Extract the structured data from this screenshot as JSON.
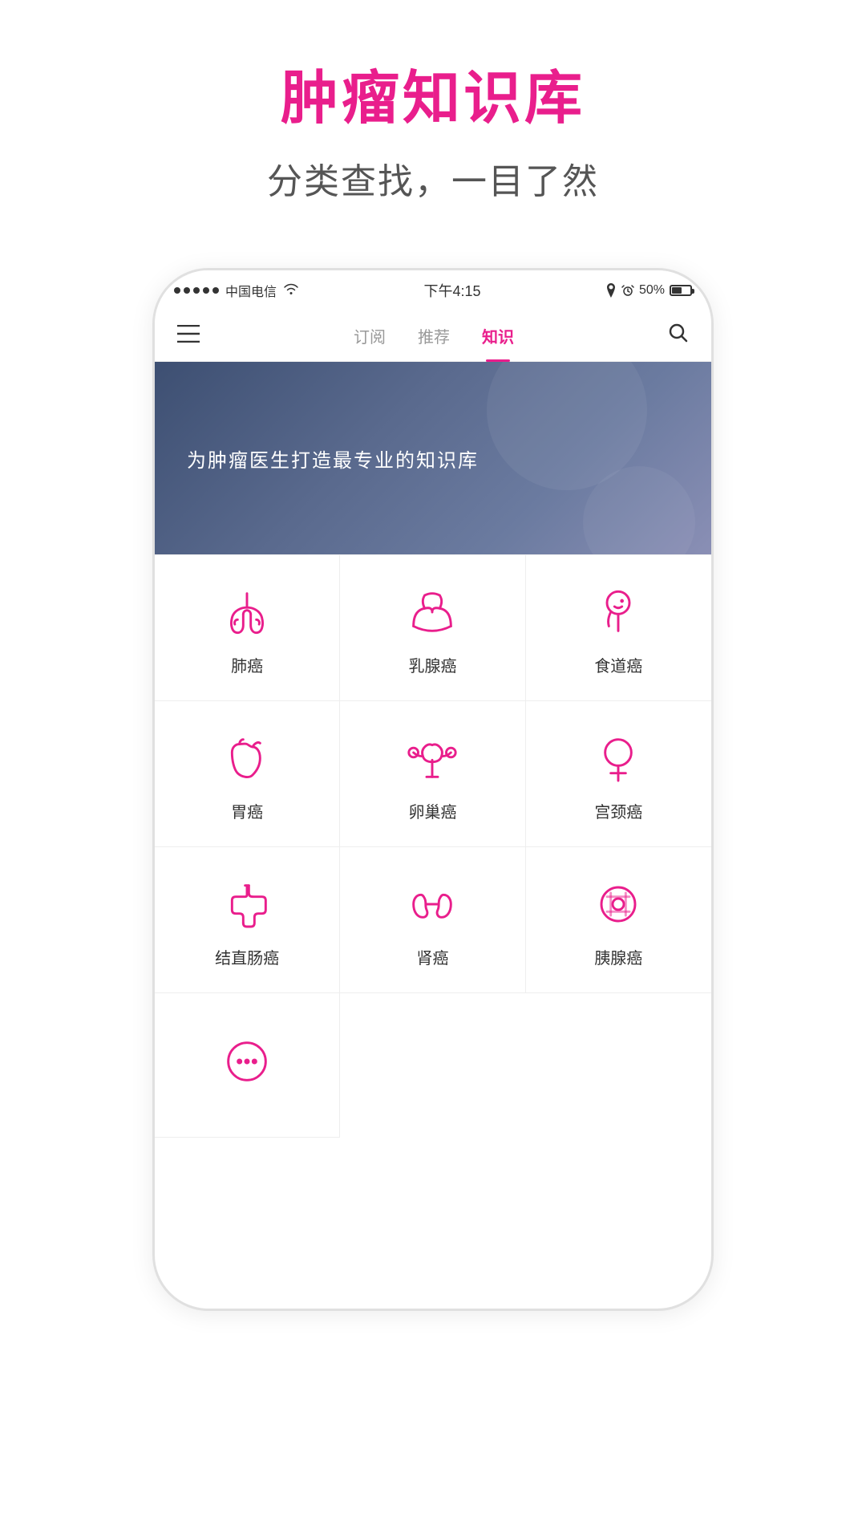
{
  "header": {
    "title": "肿瘤知识库",
    "subtitle": "分类查找，一目了然"
  },
  "statusBar": {
    "carrier": "中国电信",
    "time": "下午4:15",
    "battery": "50%"
  },
  "navBar": {
    "tabs": [
      {
        "label": "订阅",
        "active": false
      },
      {
        "label": "推荐",
        "active": false
      },
      {
        "label": "知识",
        "active": true
      }
    ]
  },
  "banner": {
    "text": "为肿瘤医生打造最专业的知识库"
  },
  "grid": {
    "items": [
      {
        "id": "lung",
        "label": "肺癌",
        "icon": "lung"
      },
      {
        "id": "breast",
        "label": "乳腺癌",
        "icon": "breast"
      },
      {
        "id": "esophagus",
        "label": "食道癌",
        "icon": "esophagus"
      },
      {
        "id": "stomach",
        "label": "胃癌",
        "icon": "stomach"
      },
      {
        "id": "ovary",
        "label": "卵巢癌",
        "icon": "ovary"
      },
      {
        "id": "cervix",
        "label": "宫颈癌",
        "icon": "cervix"
      },
      {
        "id": "colon",
        "label": "结直肠癌",
        "icon": "colon"
      },
      {
        "id": "kidney",
        "label": "肾癌",
        "icon": "kidney"
      },
      {
        "id": "pancreas",
        "label": "胰腺癌",
        "icon": "pancreas"
      },
      {
        "id": "more",
        "label": "",
        "icon": "more"
      }
    ]
  },
  "colors": {
    "accent": "#e91e8c",
    "bannerBg": "#3d4f72"
  }
}
